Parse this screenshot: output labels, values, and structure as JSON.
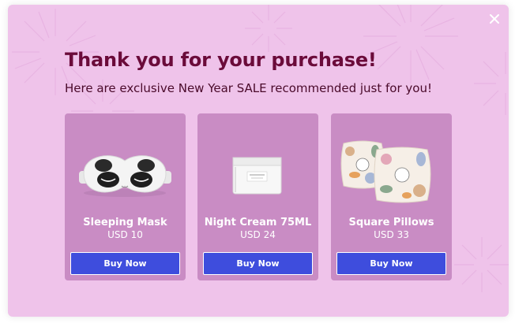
{
  "popup": {
    "title": "Thank you for your purchase!",
    "subtitle": "Here are exclusive New Year SALE recommended just for you!",
    "close_icon": "close-icon",
    "colors": {
      "background": "#efc3ea",
      "card": "#c98cc4",
      "title": "#6b0b3a",
      "button": "#3e4ddd"
    }
  },
  "products": [
    {
      "name": "Sleeping Mask",
      "price": "USD 10",
      "button_label": "Buy Now",
      "image_icon": "sleeping-mask-image"
    },
    {
      "name": "Night Cream 75ML",
      "price": "USD 24",
      "button_label": "Buy Now",
      "image_icon": "night-cream-jar-image"
    },
    {
      "name": "Square Pillows",
      "price": "USD 33",
      "button_label": "Buy Now",
      "image_icon": "square-pillows-image"
    }
  ]
}
